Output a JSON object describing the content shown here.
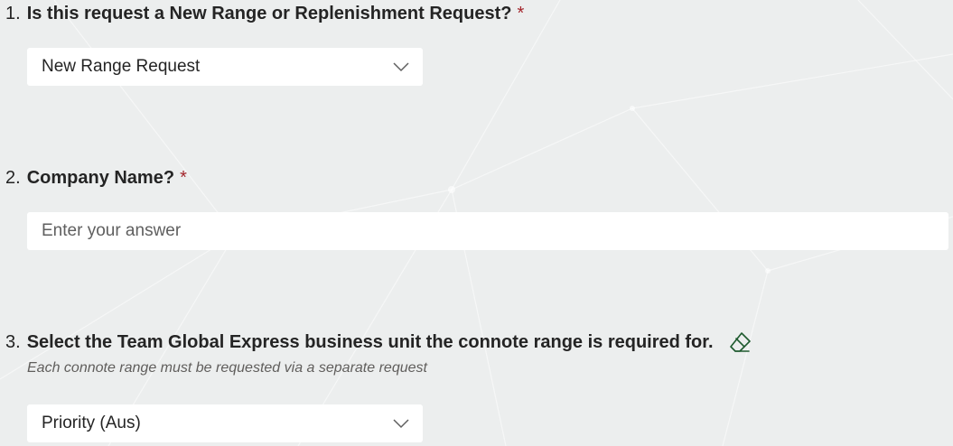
{
  "questions": [
    {
      "number": "1.",
      "title": "Is this request a New Range or Replenishment Request?",
      "required_mark": "*",
      "type": "dropdown",
      "selected_value": "New Range Request",
      "icon": "chevron-down-icon"
    },
    {
      "number": "2.",
      "title": "Company Name?",
      "required_mark": "*",
      "type": "text",
      "value": "",
      "placeholder": "Enter your answer"
    },
    {
      "number": "3.",
      "title": "Select the Team Global Express business unit the connote range is required for.",
      "subtitle": "Each connote range must be requested via a separate request",
      "type": "dropdown",
      "selected_value": "Priority (Aus)",
      "clear_icon": "eraser-icon",
      "icon": "chevron-down-icon"
    }
  ],
  "colors": {
    "background": "#eceeee",
    "required": "#a4262c",
    "text": "#242424",
    "subtitle": "#605e5c",
    "eraser": "#1e5a2e"
  }
}
